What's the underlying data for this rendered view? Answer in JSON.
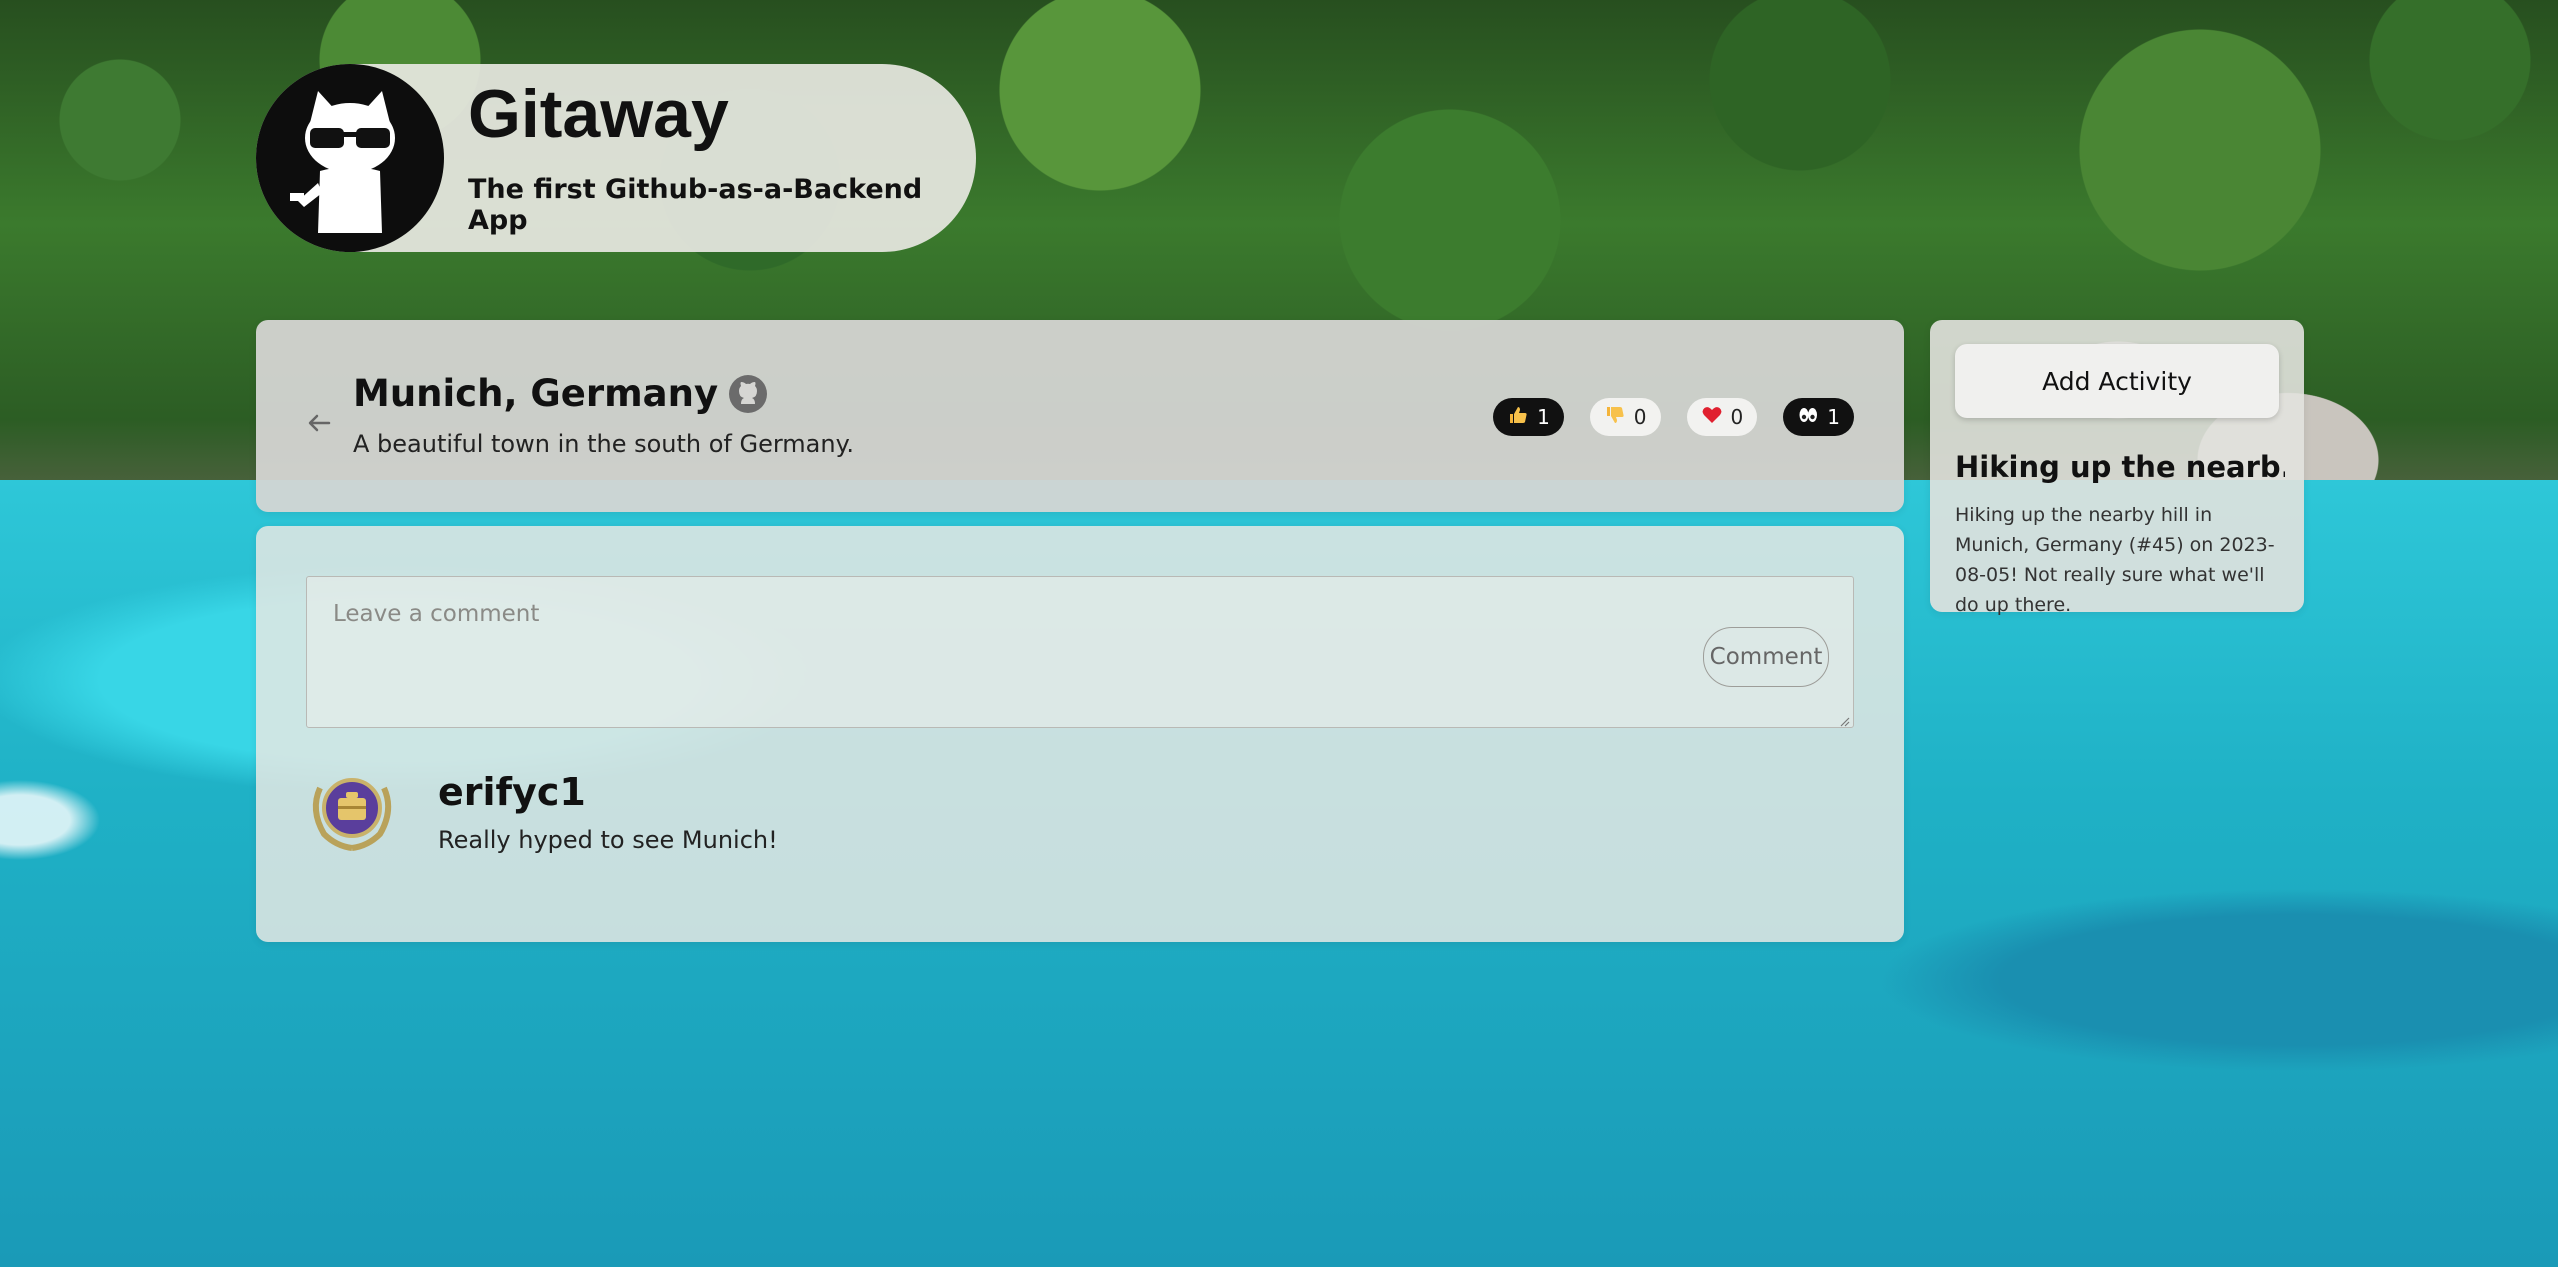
{
  "brand": {
    "title": "Gitaway",
    "subtitle": "The first Github-as-a-Backend App",
    "logo_icon": "octocat-sunglasses-icon"
  },
  "trip": {
    "title": "Munich, Germany",
    "description": "A beautiful town in the south of Germany.",
    "github_icon": "github-icon",
    "back_icon": "arrow-left-icon",
    "reactions": [
      {
        "icon": "thumbs-up-icon",
        "count": "1",
        "active": true
      },
      {
        "icon": "thumbs-down-icon",
        "count": "0",
        "active": false
      },
      {
        "icon": "heart-icon",
        "count": "0",
        "active": false
      },
      {
        "icon": "eyes-icon",
        "count": "1",
        "active": true
      }
    ]
  },
  "comment_form": {
    "placeholder": "Leave a comment",
    "submit_label": "Comment"
  },
  "comments": [
    {
      "user": "erifyc1",
      "text": "Really hyped to see Munich!",
      "avatar_icon": "avatar-badge-icon"
    }
  ],
  "sidebar": {
    "add_activity_label": "Add Activity",
    "activities": [
      {
        "title": "Hiking up the nearb...",
        "description": "Hiking up the nearby hill in Munich, Germany (#45) on 2023-08-05! Not really sure what we'll do up there."
      }
    ]
  },
  "colors": {
    "reaction_active_bg": "#111111",
    "reaction_inactive_bg": "#f2f2f0",
    "panel_bg": "#e4e4e0"
  }
}
